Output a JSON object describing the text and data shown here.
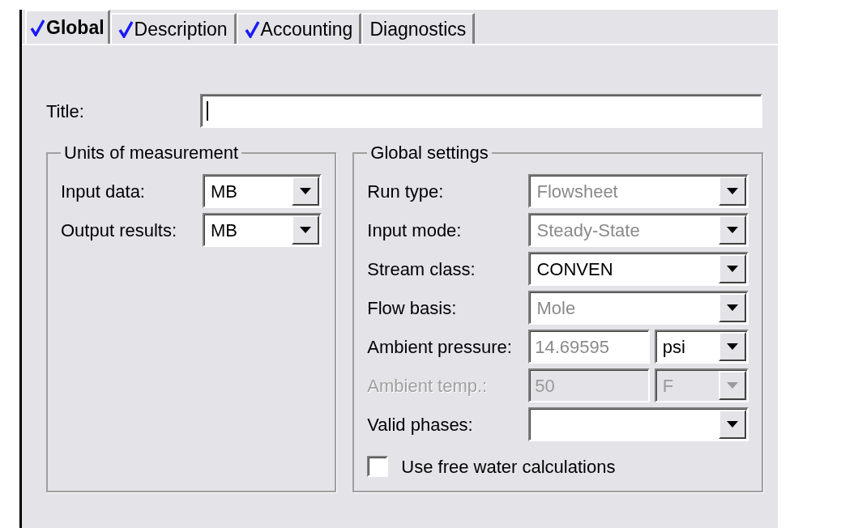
{
  "tabs": [
    {
      "label": "Global",
      "checked": true,
      "selected": true
    },
    {
      "label": "Description",
      "checked": true,
      "selected": false
    },
    {
      "label": "Accounting",
      "checked": true,
      "selected": false
    },
    {
      "label": "Diagnostics",
      "checked": false,
      "selected": false
    }
  ],
  "title_field": {
    "label": "Title:",
    "focused": true
  },
  "units_group": {
    "legend": "Units of measurement",
    "rows": [
      {
        "label": "Input data:",
        "fields": [
          {
            "kind": "combo",
            "value": "MB",
            "greyed": false,
            "disabled": false
          }
        ]
      },
      {
        "label": "Output results:",
        "fields": [
          {
            "kind": "combo",
            "value": "MB",
            "greyed": false,
            "disabled": false
          }
        ]
      }
    ]
  },
  "settings_group": {
    "legend": "Global settings",
    "rows": [
      {
        "label": "Run type:",
        "disabled": false,
        "fields": [
          {
            "kind": "combo",
            "value": "Flowsheet",
            "greyed": true,
            "disabled": false
          }
        ]
      },
      {
        "label": "Input mode:",
        "disabled": false,
        "fields": [
          {
            "kind": "combo",
            "value": "Steady-State",
            "greyed": true,
            "disabled": false
          }
        ]
      },
      {
        "label": "Stream class:",
        "disabled": false,
        "fields": [
          {
            "kind": "combo",
            "value": "CONVEN",
            "greyed": false,
            "disabled": false
          }
        ]
      },
      {
        "label": "Flow basis:",
        "disabled": false,
        "fields": [
          {
            "kind": "combo",
            "value": "Mole",
            "greyed": true,
            "disabled": false
          }
        ]
      },
      {
        "label": "Ambient pressure:",
        "disabled": false,
        "fields": [
          {
            "kind": "text",
            "value": "14.69595",
            "greyed": true,
            "disabled": false
          },
          {
            "kind": "combo",
            "value": "psi",
            "greyed": false,
            "disabled": false
          }
        ]
      },
      {
        "label": "Ambient temp.:",
        "disabled": true,
        "fields": [
          {
            "kind": "text",
            "value": "50",
            "disabled": true
          },
          {
            "kind": "combo",
            "value": "F",
            "disabled": true
          }
        ]
      },
      {
        "label": "Valid phases:",
        "disabled": false,
        "fields": [
          {
            "kind": "combo",
            "disabled": false
          }
        ]
      }
    ],
    "checkbox": {
      "label": "Use free water calculations",
      "checked": false
    }
  }
}
